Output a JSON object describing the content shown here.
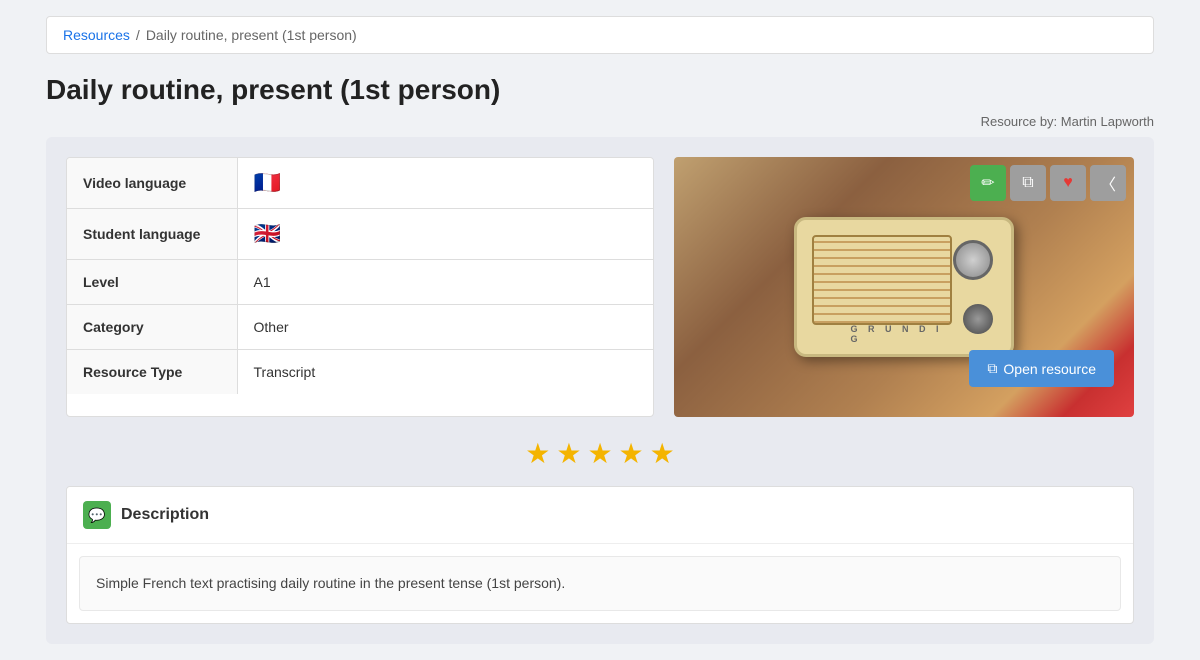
{
  "breadcrumb": {
    "link_text": "Resources",
    "separator": "/",
    "current": "Daily routine, present (1st person)"
  },
  "page": {
    "title": "Daily routine, present (1st person)",
    "resource_by": "Resource by: Martin Lapworth"
  },
  "info_table": {
    "rows": [
      {
        "label": "Video language",
        "type": "flag",
        "value": "🇫🇷"
      },
      {
        "label": "Student language",
        "type": "flag",
        "value": "🇬🇧"
      },
      {
        "label": "Level",
        "type": "text",
        "value": "A1"
      },
      {
        "label": "Category",
        "type": "text",
        "value": "Other"
      },
      {
        "label": "Resource Type",
        "type": "text",
        "value": "Transcript"
      }
    ]
  },
  "toolbar": {
    "edit_label": "✏",
    "copy_label": "⧉",
    "heart_label": "♥",
    "share_label": "≪"
  },
  "open_resource": {
    "label": "Open resource",
    "icon": "↗"
  },
  "stars": {
    "count": 5,
    "symbol": "★"
  },
  "description": {
    "header_icon": "≡",
    "title": "Description",
    "body": "Simple French text practising daily routine in the present tense (1st person)."
  },
  "radio_brand": "G R U N D I G"
}
